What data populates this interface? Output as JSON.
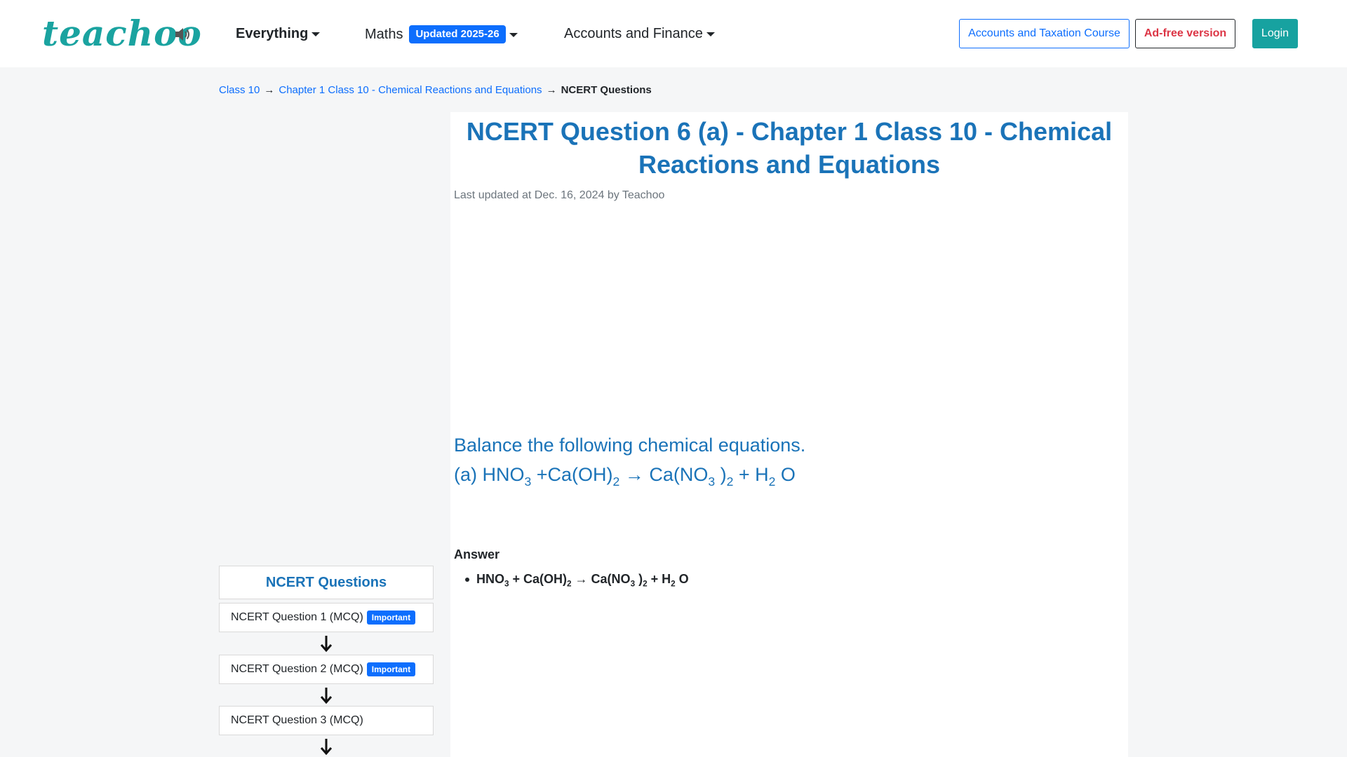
{
  "navbar": {
    "logo": "teachoo",
    "menu": {
      "everything": "Everything",
      "maths": "Maths",
      "maths_badge": "Updated 2025-26",
      "accounts": "Accounts and Finance"
    },
    "buttons": {
      "course": "Accounts and Taxation Course",
      "adfree": "Ad-free version",
      "login": "Login"
    },
    "icons": {
      "speaker": "speaker-icon"
    }
  },
  "breadcrumb": {
    "item1": "Class 10",
    "item2": "Chapter 1 Class 10 - Chemical Reactions and Equations",
    "current": "NCERT Questions",
    "separator": "→"
  },
  "article": {
    "title": "NCERT Question 6 (a) - Chapter 1 Class 10 - Chemical Reactions and Equations",
    "updated": "Last updated at Dec. 16, 2024 by Teachoo",
    "question_line1": "Balance the following chemical equations.",
    "question_eq": {
      "prefix": "(a) HNO",
      "s1": "3",
      "t2": " +Ca(OH)",
      "s2": "2",
      "t3": " → Ca(NO",
      "s3": "3",
      "t4": " )",
      "s4": "2",
      "t5": " + H",
      "s5": "2",
      "t6": " O"
    },
    "answer_label": "Answer",
    "answer_eq": {
      "t1": "HNO",
      "s1": "3",
      "t2": " + Ca(OH)",
      "s2": "2",
      "t3": " → Ca(NO",
      "s3": "3",
      "t4": " )",
      "s4": "2",
      "t5": " + H",
      "s5": "2",
      "t6": " O"
    }
  },
  "sidebar": {
    "heading": "NCERT Questions",
    "items": [
      {
        "label": "NCERT Question 1 (MCQ)",
        "badge": "Important"
      },
      {
        "label": "NCERT Question 2 (MCQ)",
        "badge": "Important"
      },
      {
        "label": "NCERT Question 3 (MCQ)",
        "badge": ""
      }
    ]
  },
  "colors": {
    "brand_teal": "#1aa3a0",
    "title_blue": "#1a73b8",
    "link_blue": "#0d6efd",
    "danger_red": "#dc3545"
  }
}
